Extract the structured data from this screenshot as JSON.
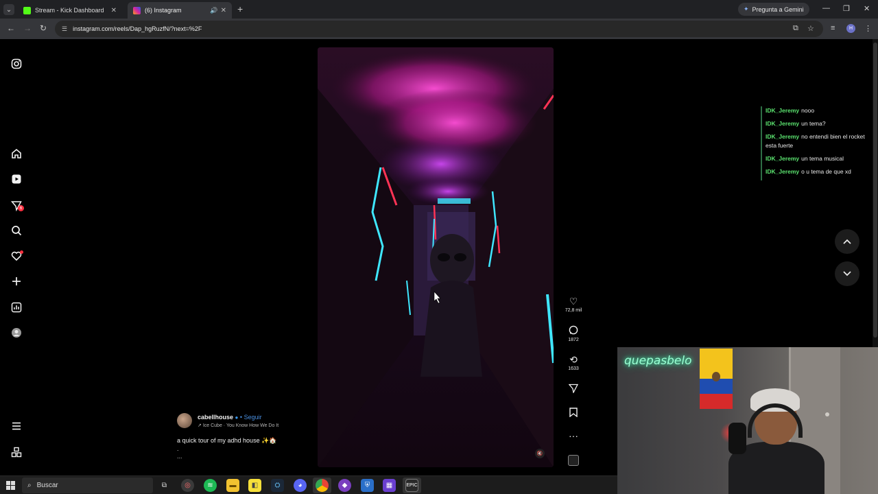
{
  "browser": {
    "tabs": [
      {
        "title": "Stream - Kick Dashboard",
        "favicon_color": "#53fc18"
      },
      {
        "title": "(6) Instagram",
        "favicon_color": "#d6249f"
      }
    ],
    "gemini_label": "Pregunta a Gemini",
    "url": "instagram.com/reels/Dap_hgRuzfN/?next=%2F",
    "profile_initial": "H"
  },
  "sidebar": {
    "icons": [
      "instagram-logo-icon",
      "home-icon",
      "reels-icon",
      "messages-icon",
      "search-icon",
      "notifications-icon",
      "create-icon",
      "dashboard-icon",
      "profile-icon",
      "menu-icon",
      "more-apps-icon"
    ],
    "messages_badge": "6"
  },
  "reel": {
    "author": "cabellhouse",
    "follow_label": "Seguir",
    "audio": "Ice Cube · You Know How We Do It",
    "caption": "a quick tour of my adhd house ✨🏠",
    "caption_dot": ".",
    "caption_more": "...",
    "likes": "72,8 mil",
    "comments": "1872",
    "reposts": "1633"
  },
  "chat": {
    "messages": [
      {
        "user": "IDK_Jeremy",
        "text": "nooo"
      },
      {
        "user": "IDK_Jeremy",
        "text": "un tema?"
      },
      {
        "user": "IDK_Jeremy",
        "text": "no entendi bien el rocket esta fuerte"
      },
      {
        "user": "IDK_Jeremy",
        "text": "un tema musical"
      },
      {
        "user": "IDK_Jeremy",
        "text": "o u tema de que xd"
      }
    ],
    "user_color": "#5be36f"
  },
  "webcam": {
    "neon_sign": "quepasbelo"
  },
  "taskbar": {
    "search_placeholder": "Buscar",
    "apps": [
      "task-view-icon",
      "app-icon",
      "spotify-icon",
      "file-explorer-icon",
      "sticky-notes-icon",
      "steam-icon",
      "discord-icon",
      "chrome-icon",
      "app-icon",
      "app-icon",
      "app-icon",
      "epic-games-icon"
    ]
  }
}
